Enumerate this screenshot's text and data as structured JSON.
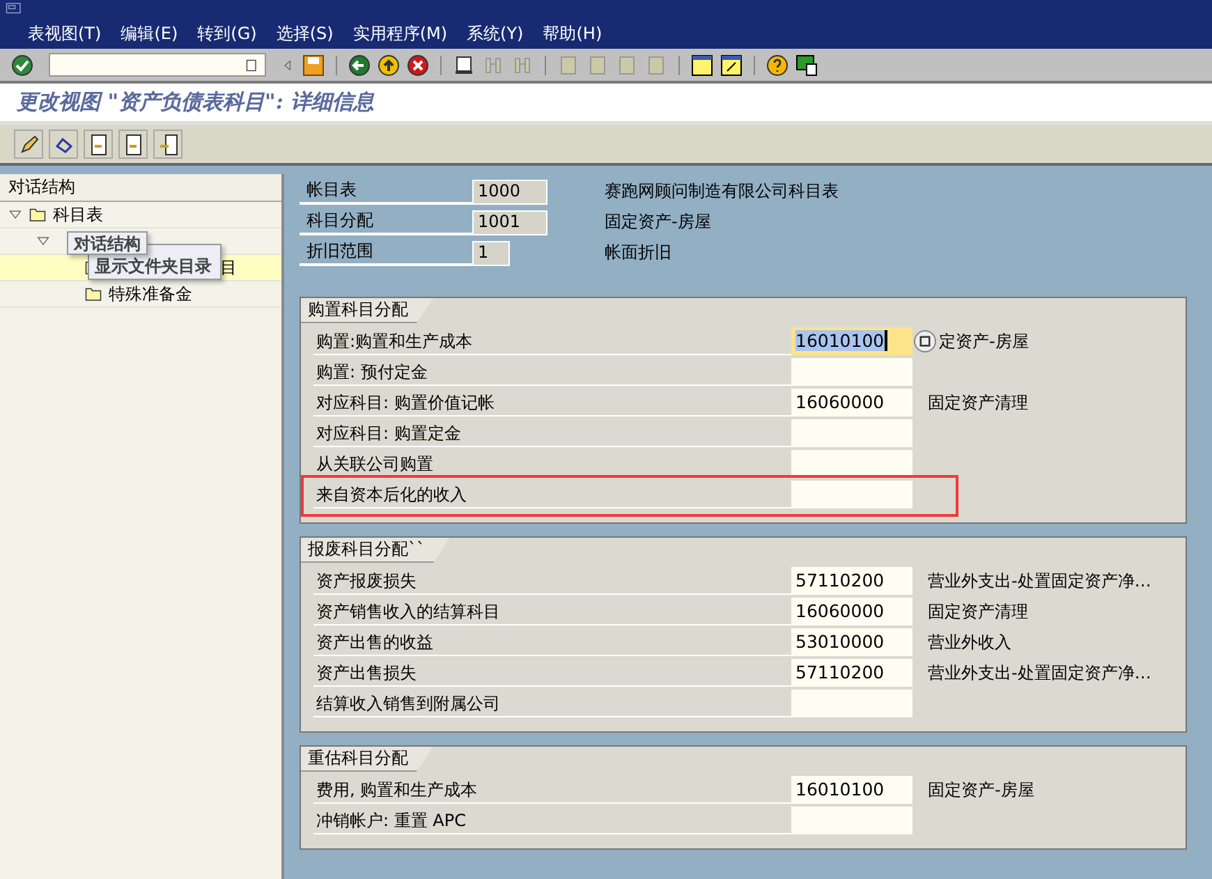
{
  "menu": [
    "表视图(T)",
    "编辑(E)",
    "转到(G)",
    "选择(S)",
    "实用程序(M)",
    "系统(Y)",
    "帮助(H)"
  ],
  "title": "更改视图 \"资产负债表科目\": 详细信息",
  "tree": {
    "header": "对话结构",
    "items": [
      {
        "label": "科目表",
        "expanded": true,
        "selected": false,
        "children": [
          {
            "expanded": true,
            "selected": false,
            "children": [
              {
                "label": "目",
                "selected": true
              },
              {
                "label": "特殊准备金",
                "selected": false
              }
            ]
          }
        ]
      }
    ]
  },
  "tooltips": [
    "对话结构",
    "显示文件夹目录"
  ],
  "header_fields": [
    {
      "label": "帐目表",
      "value": "1000",
      "description": "赛跑网顾问制造有限公司科目表"
    },
    {
      "label": "科目分配",
      "value": "1001",
      "description": "固定资产-房屋"
    },
    {
      "label": "折旧范围",
      "value": "1",
      "description": "帐面折旧"
    }
  ],
  "groups": [
    {
      "title": "购置科目分配",
      "rows": [
        {
          "label": "购置:购置和生产成本",
          "value": "16010100",
          "description": "定资产-房屋",
          "focused": true,
          "highlighted": false
        },
        {
          "label": "购置: 预付定金",
          "focused": false,
          "highlighted": false
        },
        {
          "label": "对应科目: 购置价值记帐",
          "value": "16060000",
          "description": "固定资产清理",
          "focused": false,
          "highlighted": false
        },
        {
          "label": "对应科目: 购置定金",
          "focused": false,
          "highlighted": false
        },
        {
          "label": "从关联公司购置",
          "focused": false,
          "highlighted": false
        },
        {
          "label": "来自资本后化的收入",
          "focused": false,
          "highlighted": true
        }
      ]
    },
    {
      "title": "报废科目分配``",
      "rows": [
        {
          "label": "资产报废损失",
          "value": "57110200",
          "description": "营业外支出-处置固定资产净…",
          "focused": false,
          "highlighted": false
        },
        {
          "label": "资产销售收入的结算科目",
          "value": "16060000",
          "description": "固定资产清理",
          "focused": false,
          "highlighted": false
        },
        {
          "label": "资产出售的收益",
          "value": "53010000",
          "description": "营业外收入",
          "focused": false,
          "highlighted": false
        },
        {
          "label": "资产出售损失",
          "value": "57110200",
          "description": "营业外支出-处置固定资产净…",
          "focused": false,
          "highlighted": false
        },
        {
          "label": "结算收入销售到附属公司",
          "focused": false,
          "highlighted": false
        }
      ]
    },
    {
      "title": "重估科目分配",
      "rows": [
        {
          "label": "费用, 购置和生产成本",
          "value": "16010100",
          "description": "固定资产-房屋",
          "focused": false,
          "highlighted": false
        },
        {
          "label": "冲销帐户: 重置 APC",
          "focused": false,
          "highlighted": false
        }
      ]
    }
  ]
}
